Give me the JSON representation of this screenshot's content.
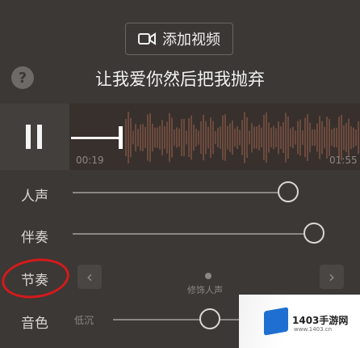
{
  "header": {
    "add_video_label": "添加视频",
    "lyric": "让我爱你然后把我抛弃"
  },
  "player": {
    "current_time": "00:19",
    "total_time": "01:55",
    "progress": 0.17
  },
  "sliders": {
    "vocal": {
      "label": "人声",
      "value": 0.98
    },
    "accompaniment": {
      "label": "伴奏",
      "value": 0.98
    },
    "rhythm": {
      "label": "节奏",
      "caption": "修饰人声",
      "prev_icon": "chevron-left-icon",
      "next_icon": "chevron-right-icon"
    },
    "timbre": {
      "label": "音色",
      "left_label": "低沉",
      "value": 0.42
    }
  },
  "annotation": {
    "color": "#d41a1a"
  },
  "watermark": {
    "brand": "1403手游网",
    "url": "www.1403.cn"
  }
}
